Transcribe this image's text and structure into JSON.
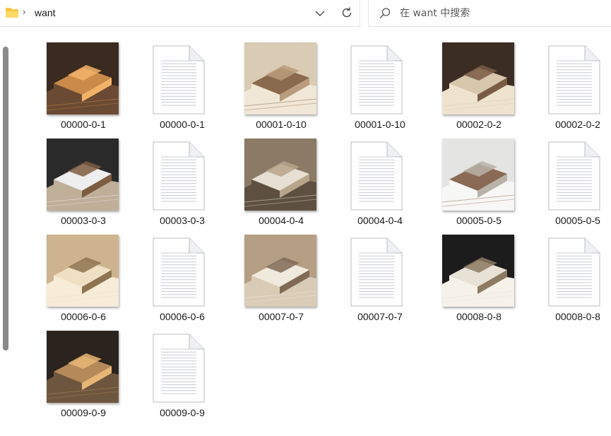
{
  "address_bar": {
    "folder_icon": "folder-icon",
    "separator": "›",
    "path": "want"
  },
  "search": {
    "placeholder": "在 want 中搜索"
  },
  "files": [
    {
      "name": "00000-0-1",
      "type": "image"
    },
    {
      "name": "00000-0-1",
      "type": "document"
    },
    {
      "name": "00001-0-10",
      "type": "image"
    },
    {
      "name": "00001-0-10",
      "type": "document"
    },
    {
      "name": "00002-0-2",
      "type": "image"
    },
    {
      "name": "00002-0-2",
      "type": "document"
    },
    {
      "name": "00003-0-3",
      "type": "image"
    },
    {
      "name": "00003-0-3",
      "type": "document"
    },
    {
      "name": "00004-0-4",
      "type": "image"
    },
    {
      "name": "00004-0-4",
      "type": "document"
    },
    {
      "name": "00005-0-5",
      "type": "image"
    },
    {
      "name": "00005-0-5",
      "type": "document"
    },
    {
      "name": "00006-0-6",
      "type": "image"
    },
    {
      "name": "00006-0-6",
      "type": "document"
    },
    {
      "name": "00007-0-7",
      "type": "image"
    },
    {
      "name": "00007-0-7",
      "type": "document"
    },
    {
      "name": "00008-0-8",
      "type": "image"
    },
    {
      "name": "00008-0-8",
      "type": "document"
    },
    {
      "name": "00009-0-9",
      "type": "image"
    },
    {
      "name": "00009-0-9",
      "type": "document"
    }
  ],
  "colors": {
    "folder": "#f5c542",
    "accent": "#0067c0",
    "scrollbar": "#8a8a8a"
  }
}
